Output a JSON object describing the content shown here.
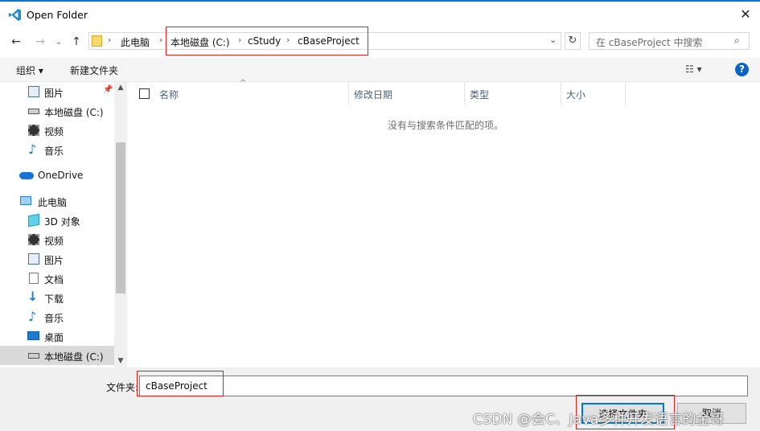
{
  "window": {
    "title": "Open Folder",
    "accent": "#0078d7"
  },
  "nav_buttons": {
    "back": "←",
    "forward": "→",
    "dropdown": "⌄",
    "up": "↑"
  },
  "address": {
    "crumbs": [
      "此电脑",
      "本地磁盘 (C:)",
      "cStudy",
      "cBaseProject"
    ],
    "separator": "›"
  },
  "search": {
    "placeholder": "在 cBaseProject 中搜索"
  },
  "toolbar": {
    "organize": "组织 ▾",
    "new_folder": "新建文件夹",
    "view": "☷ ▾",
    "help": "?"
  },
  "nav_pane": {
    "items": [
      {
        "label": "图片",
        "icon": "pictures-icon",
        "pinned": true
      },
      {
        "label": "本地磁盘 (C:)",
        "icon": "drive-icon"
      },
      {
        "label": "视频",
        "icon": "video-icon"
      },
      {
        "label": "音乐",
        "icon": "music-icon"
      },
      {
        "label": "OneDrive",
        "icon": "onedrive-icon"
      },
      {
        "label": "此电脑",
        "icon": "computer-icon"
      },
      {
        "label": "3D 对象",
        "icon": "3d-objects-icon"
      },
      {
        "label": "视频",
        "icon": "video-icon"
      },
      {
        "label": "图片",
        "icon": "pictures-icon"
      },
      {
        "label": "文档",
        "icon": "documents-icon"
      },
      {
        "label": "下载",
        "icon": "download-icon"
      },
      {
        "label": "音乐",
        "icon": "music-icon"
      },
      {
        "label": "桌面",
        "icon": "desktop-icon"
      },
      {
        "label": "本地磁盘 (C:)",
        "icon": "drive-icon",
        "selected": true
      }
    ]
  },
  "file_list": {
    "columns": [
      "名称",
      "修改日期",
      "类型",
      "大小"
    ],
    "empty_message": "没有与搜索条件匹配的项。"
  },
  "bottom": {
    "folder_label": "文件夹:",
    "folder_value": "cBaseProject",
    "select_button": "选择文件夹",
    "cancel_button": "取消"
  },
  "watermark": "CSDN @会C、Java多种开发语言的金哥"
}
